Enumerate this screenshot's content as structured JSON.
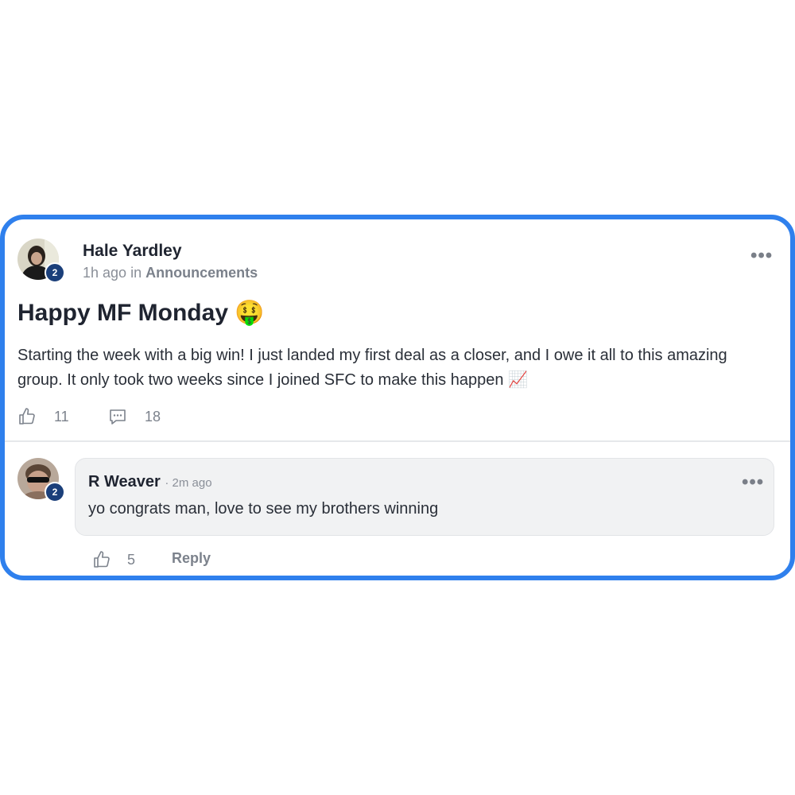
{
  "post": {
    "author": "Hale Yardley",
    "level": "2",
    "time": "1h ago",
    "in_word": "in",
    "category": "Announcements",
    "title": "Happy MF Monday",
    "title_emoji": "🤑",
    "body": "Starting the week with a big win! I just landed my first deal as a closer, and I owe it all to this amazing group. It only took two weeks since I joined SFC to make this happen 📈",
    "likes": "11",
    "comments": "18",
    "more": "•••"
  },
  "comment": {
    "author": "R Weaver",
    "level": "2",
    "time": "· 2m ago",
    "text": "yo congrats man, love to see my brothers winning",
    "likes": "5",
    "reply_label": "Reply",
    "more": "•••"
  },
  "icons": {
    "like": "thumbs-up-icon",
    "comment": "comment-bubble-icon",
    "more": "more-horizontal-icon"
  },
  "colors": {
    "card_border": "#2f80ed",
    "level_badge": "#1b3f7a",
    "comment_bg": "#f1f2f3"
  }
}
